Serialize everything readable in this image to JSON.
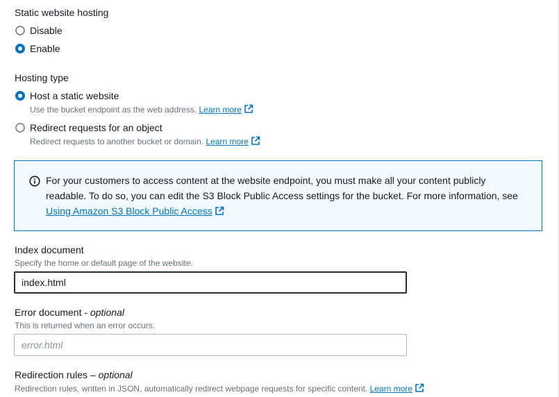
{
  "static_hosting": {
    "heading": "Static website hosting",
    "options": [
      {
        "label": "Disable",
        "selected": false
      },
      {
        "label": "Enable",
        "selected": true
      }
    ]
  },
  "hosting_type": {
    "heading": "Hosting type",
    "options": [
      {
        "label": "Host a static website",
        "description": "Use the bucket endpoint as the web address.",
        "link": "Learn more",
        "selected": true
      },
      {
        "label": "Redirect requests for an object",
        "description": "Redirect requests to another bucket or domain.",
        "link": "Learn more",
        "selected": false
      }
    ]
  },
  "info_alert": {
    "text": "For your customers to access content at the website endpoint, you must make all your content publicly readable. To do so, you can edit the S3 Block Public Access settings for the bucket. For more information, see",
    "link": "Using Amazon S3 Block Public Access"
  },
  "index_document": {
    "label": "Index document",
    "description": "Specify the home or default page of the website.",
    "value": "index.html"
  },
  "error_document": {
    "label": "Error document - ",
    "optional": "optional",
    "description": "This is returned when an error occurs.",
    "placeholder": "error.html",
    "value": ""
  },
  "redirection_rules": {
    "label": "Redirection rules – ",
    "optional": "optional",
    "description": "Redirection rules, written in JSON, automatically redirect webpage requests for specific content.",
    "link": "Learn more"
  },
  "colors": {
    "accent": "#0073bb",
    "info_bg": "#f1faff",
    "text": "#16191f",
    "muted": "#687078"
  }
}
